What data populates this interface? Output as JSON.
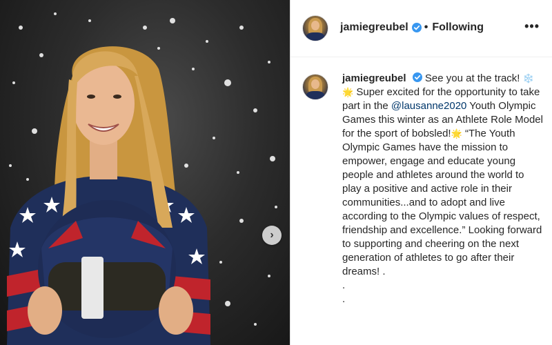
{
  "post": {
    "username": "jamiegreubel",
    "follow_separator": "•",
    "follow_status": "Following",
    "more_options": "•••",
    "next_button": "›",
    "caption": {
      "username": "jamiegreubel",
      "part1": "See you at the track!",
      "emoji1": "❄️",
      "emoji2": "🌟",
      "part2": "Super excited for the opportunity to take part in the",
      "mention": "@lausanne2020",
      "part3": "Youth Olympic Games this winter as an Athlete Role Model for the sport of bobsled!",
      "emoji3": "🌟",
      "part4": "“The Youth Olympic Games have the mission to empower, engage and educate young people and athletes around the world to play a positive and active role in their communities...and to adopt and live according to the Olympic values of respect, friendship and excellence.” Looking forward to supporting and cheering on the next generation of athletes to go after their dreams! .",
      "dot1": ".",
      "dot2": "."
    }
  },
  "colors": {
    "verified": "#3897f0",
    "mention": "#00376b",
    "text": "#262626",
    "suit_navy": "#1f2f5a",
    "suit_red": "#c0242c",
    "hair": "#d8a85a"
  },
  "photo": {
    "subject": "athlete in stars-and-stripes suit holding bobsled helmet with falling snow"
  }
}
